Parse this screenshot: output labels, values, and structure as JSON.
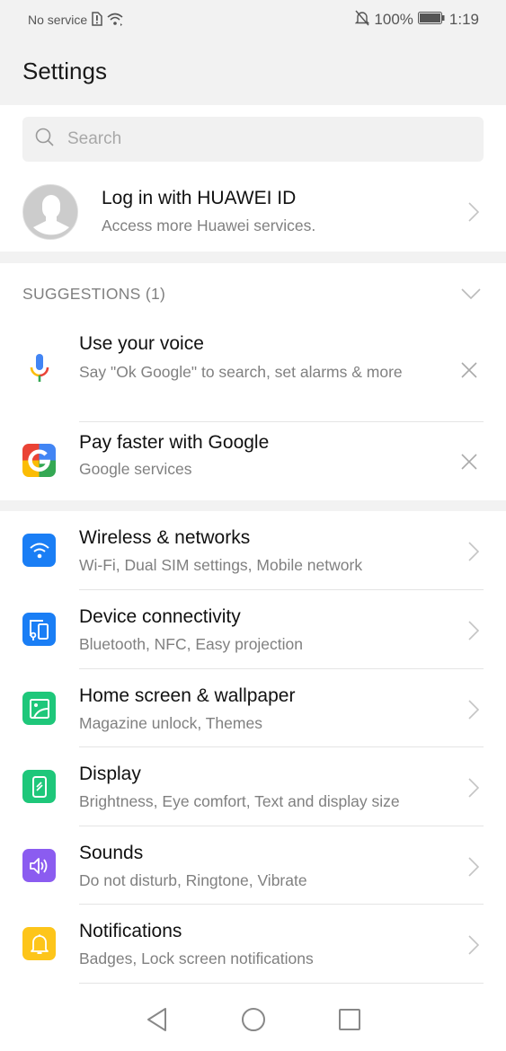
{
  "status_bar": {
    "carrier": "No service",
    "sim_icon": "sim-alert-icon",
    "wifi_icon": "wifi-icon",
    "silent_icon": "bell-off-icon",
    "battery_percent": "100%",
    "battery_level": 1.0,
    "time": "1:19"
  },
  "header": {
    "title": "Settings"
  },
  "search": {
    "placeholder": "Search",
    "value": ""
  },
  "account": {
    "title": "Log in with HUAWEI ID",
    "subtitle": "Access more Huawei services."
  },
  "suggestions": {
    "header": "SUGGESTIONS (1)",
    "items": [
      {
        "title": "Use your voice",
        "subtitle": "Say \"Ok Google\" to search, set alarms & more",
        "icon": "google-mic-icon"
      },
      {
        "title": "Pay faster with Google",
        "subtitle": "Google services",
        "icon": "google-g-icon"
      }
    ]
  },
  "settings": {
    "items": [
      {
        "title": "Wireless & networks",
        "subtitle": "Wi-Fi, Dual SIM settings, Mobile network",
        "icon": "wifi-icon",
        "color": "#1a7ef5"
      },
      {
        "title": "Device connectivity",
        "subtitle": "Bluetooth, NFC, Easy projection",
        "icon": "devices-icon",
        "color": "#1a7ef5"
      },
      {
        "title": "Home screen & wallpaper",
        "subtitle": "Magazine unlock, Themes",
        "icon": "wallpaper-icon",
        "color": "#1ec77a"
      },
      {
        "title": "Display",
        "subtitle": "Brightness, Eye comfort, Text and display size",
        "icon": "display-icon",
        "color": "#1ec77a"
      },
      {
        "title": "Sounds",
        "subtitle": "Do not disturb, Ringtone, Vibrate",
        "icon": "speaker-icon",
        "color": "#8b5cf0"
      },
      {
        "title": "Notifications",
        "subtitle": "Badges, Lock screen notifications",
        "icon": "bell-icon",
        "color": "#fdc51a"
      }
    ]
  },
  "navbar": {
    "back": "back-icon",
    "home": "home-icon",
    "recents": "recents-icon"
  }
}
